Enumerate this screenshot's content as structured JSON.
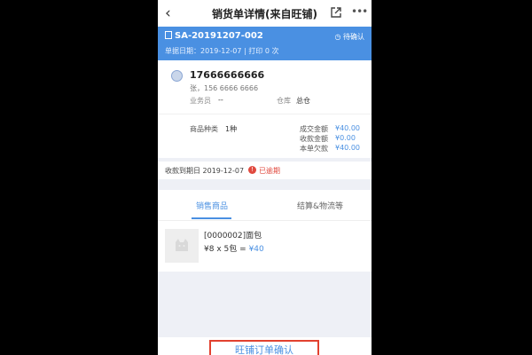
{
  "nav": {
    "title": "销货单详情(来自旺铺)",
    "back_icon": "‹",
    "more_icon": "•••"
  },
  "header": {
    "doc_no": "SA-20191207-002",
    "status": "待确认",
    "date_line": "单据日期：2019-12-07 | 打印 0 次",
    "accent": "#4a90e2"
  },
  "customer": {
    "phone": "17666666666",
    "contact": "张，156 6666 6666",
    "salesperson_label": "业务员",
    "salesperson_value": "--",
    "warehouse_label": "仓库",
    "warehouse_value": "总仓"
  },
  "summary": {
    "kinds_label": "商品种类",
    "kinds_value": "1种",
    "deal_label": "成交金额",
    "deal_value": "¥40.00",
    "received_label": "收款金额",
    "received_value": "¥0.00",
    "owed_label": "本单欠款",
    "owed_value": "¥40.00"
  },
  "due": {
    "text": "收款到期日 2019-12-07",
    "overdue": "已逾期",
    "warn_icon": "!"
  },
  "tabs": [
    "销售商品",
    "结算&物流等"
  ],
  "product": {
    "name": "[0000002]面包",
    "price": "¥8",
    "x": "x",
    "qty": "5包",
    "eq": "=",
    "total": "¥40"
  },
  "footer": {
    "button": "旺铺订单确认"
  }
}
